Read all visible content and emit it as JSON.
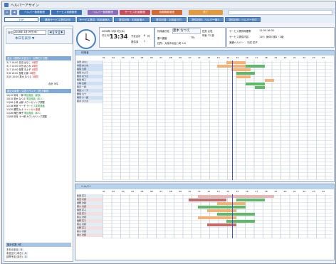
{
  "window": {
    "title": "ヘルパーアサイン"
  },
  "menubar": {
    "items": [
      "ヘルパー勤務管理",
      "サービス実績管理",
      "ヘルパー勤務管理",
      "サービス計画管理",
      "勤務職務管理",
      "終了"
    ]
  },
  "nav": {
    "tabs": [
      "TOP",
      "構造サービス提供状況",
      "サービス提供：利用者個人",
      "提供記録：利用者個人",
      "提供記録：利用者日付",
      "提供記録：ヘルパー個人",
      "提供記録：ヘルパー日付"
    ]
  },
  "date_panel": {
    "label": "日付",
    "date": "2008年 3月19日(水)",
    "prev": "◀",
    "today": "今",
    "next": "▶",
    "show_button": "本日を表示 ▼"
  },
  "left": {
    "section1_title": "直近 1週間の未割当て（訪問日7日間）",
    "list1": [
      {
        "text": "3/ 7 10:00 島田 はなこ",
        "tag": "1時間"
      },
      {
        "text": "3/ 7 12:00 中田 あさみ",
        "tag": "1時間"
      },
      {
        "text": "3/ 7 15:00 長尾 きよ子",
        "tag": "1時間"
      },
      {
        "text": "3/ 8 10:00 長尾 九郎",
        "tag": "1時間"
      },
      {
        "text": "3/10 10:00 夏木 なつえ",
        "tag": "1時間"
      }
    ],
    "list1_footer": "合計 5件",
    "section2_title": "最近の新着・注意イベント（終了期限）",
    "list2": [
      {
        "text": "10/12 晴月 一郎",
        "tag": "電話相談（家族）"
      },
      {
        "text": "10/15 夏木 なつえ",
        "tag": "電話相談（本人）"
      },
      {
        "text": "11/06 小林 太郎",
        "tag": "カウンセリング調整"
      },
      {
        "text": "11/18 雨宮 イーチ",
        "tag": "サービス変更連絡"
      },
      {
        "text": "11/20 勝間 九十",
        "tag": "キャンセル連絡"
      },
      {
        "text": "11/26 梅田 梅子",
        "tag": "電話相談（本人）"
      },
      {
        "text": "12/08 晴月 十一郎",
        "tag": "カウンセリング調整"
      }
    ],
    "bottom_title": "集計件数 5件",
    "bottom_rows": [
      "本日の割当",
      "未割当て(本日)",
      "訪問予定(本日)"
    ],
    "bottom_vals": [
      "5",
      "2",
      "3"
    ]
  },
  "info": {
    "date": "2008年 3月19日(水)",
    "time": "13:34",
    "time_label": "現在時刻",
    "plan_label": "予定合計",
    "plan_value": "6",
    "unit": "件",
    "service_label": "提供済",
    "service_value": "1",
    "user_label": "利用者氏名",
    "user_name": "夏木 なつえ",
    "gender": "性別 女性",
    "age": "年齢 72 歳",
    "care_label": "要介護度",
    "care_value": "",
    "tel_label": "TEL",
    "address": "住所：大阪市北区○町 0-0",
    "time_range_label": "サービス提供時間帯",
    "time_range": "11:00-16:00",
    "service_content_label": "サービス提供内容",
    "service_content": "110：身体介護1・2級",
    "helper_label": "実績ヘルパー",
    "helper_name": "平成 花子"
  },
  "schedule": {
    "title": "利用者",
    "hours": [
      "01",
      "02",
      "03",
      "04",
      "05",
      "06",
      "07",
      "08",
      "09",
      "10",
      "11",
      "12",
      "13",
      "14",
      "15",
      "16",
      "17",
      "18",
      "19",
      "20",
      "21",
      "22",
      "23",
      "24"
    ],
    "users": [
      "島田 はなこ",
      "中田 あさみ",
      "長尾 九郎",
      "長尾 きよ子",
      "夏木 なつえ",
      "梅田 梅子",
      "小林 太郎",
      "晴月 一郎",
      "雨宮 イーチ",
      "勝間 九十",
      "晴月 十一郎",
      "夏木 ひさお"
    ],
    "user_colors": [
      "#e8eef6",
      "#cfe0f5",
      "#cfe0f5",
      "#e8eef6",
      "#cfe0f5",
      "#e8eef6",
      "#cfe0f5",
      "#e8eef6",
      "#cfe0f5",
      "#e8eef6",
      "#cfe0f5",
      "#e8eef6"
    ]
  },
  "helpers": {
    "title": "ヘルパー",
    "hours": [
      "01",
      "02",
      "03",
      "04",
      "05",
      "06",
      "07",
      "08",
      "09",
      "10",
      "11",
      "12",
      "13",
      "14",
      "15",
      "16",
      "17",
      "18",
      "19",
      "20",
      "21",
      "22",
      "23",
      "24"
    ],
    "names": [
      "秋田 花子",
      "秋田 次郎",
      "春野 次郎",
      "夏川 次郎",
      "春田 花子",
      "冬田 花子",
      "秋山 次郎",
      "春野 花子",
      "夏山 次郎",
      "冬野 花子",
      "秋川 次郎",
      "春川 次郎"
    ]
  },
  "colors": {
    "accent": "#4b7fb8",
    "now_line": "#3c4fd6",
    "bar_orange": "#f2b27a",
    "bar_green": "#5db868",
    "bar_red": "#c76a6a",
    "bar_pink": "#e6b8b8"
  }
}
